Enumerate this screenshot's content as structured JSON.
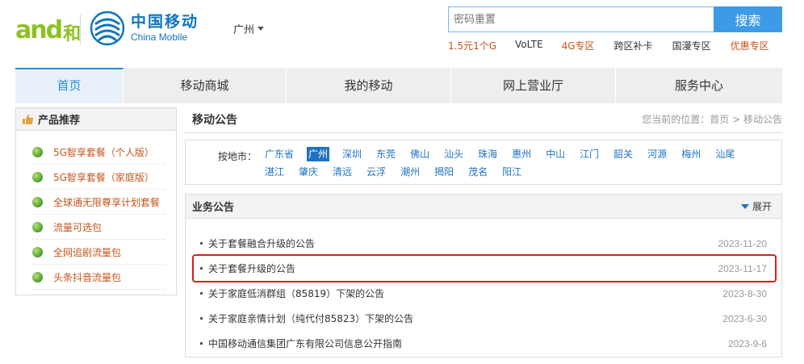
{
  "header": {
    "and_logo_text": "and",
    "he_logo_text": "和",
    "brand_cn": "中国移动",
    "brand_en": "China Mobile",
    "city": "广州",
    "search_placeholder": "密码重置",
    "search_button": "搜索",
    "quick_links": [
      {
        "label": "1.5元1个G",
        "color": "#c4541a",
        "offset": 0
      },
      {
        "label": "VoLTE",
        "color": "#333333",
        "offset": 23
      },
      {
        "label": "4G专区",
        "color": "#c4541a",
        "offset": 23
      },
      {
        "label": "跨区补卡",
        "color": "#333333",
        "offset": 24
      },
      {
        "label": "国漫专区",
        "color": "#333333",
        "offset": 24
      },
      {
        "label": "优惠专区",
        "color": "#c4541a",
        "offset": 24
      }
    ]
  },
  "nav": [
    {
      "label": "首页",
      "width": 134,
      "active": true
    },
    {
      "label": "移动商城",
      "width": 202,
      "active": false
    },
    {
      "label": "我的移动",
      "width": 204,
      "active": false
    },
    {
      "label": "网上营业厅",
      "width": 204,
      "active": false
    },
    {
      "label": "服务中心",
      "width": 206,
      "active": false
    }
  ],
  "sidebar": {
    "title": "产品推荐",
    "items": [
      "5G智享套餐（个人版）",
      "5G智享套餐（家庭版）",
      "全球通无限尊享计划套餐",
      "流量可选包",
      "全网追剧流量包",
      "头条抖音流量包"
    ]
  },
  "content": {
    "section_title": "移动公告",
    "breadcrumb_prefix": "您当前的位置：",
    "breadcrumb_home": "首页",
    "breadcrumb_sep": ">",
    "breadcrumb_current": "移动公告",
    "city_label": "按地市：",
    "cities": [
      "广东省",
      "广州",
      "深圳",
      "东莞",
      "佛山",
      "汕头",
      "珠海",
      "惠州",
      "中山",
      "江门",
      "韶关",
      "河源",
      "梅州",
      "汕尾",
      "湛江",
      "肇庆",
      "清远",
      "云浮",
      "潮州",
      "揭阳",
      "茂名",
      "阳江"
    ],
    "active_city_index": 1,
    "announcement_title": "业务公告",
    "expand_label": "展开",
    "announcements": [
      {
        "title": "关于套餐融合升级的公告",
        "date": "2023-11-20",
        "highlighted": false
      },
      {
        "title": "关于套餐升级的公告",
        "date": "2023-11-17",
        "highlighted": true
      },
      {
        "title": "关于家庭低消群组（85819）下架的公告",
        "date": "2023-8-30",
        "highlighted": false
      },
      {
        "title": "关于家庭亲情计划（纯代付85823）下架的公告",
        "date": "2023-6-30",
        "highlighted": false
      },
      {
        "title": "中国移动通信集团广东有限公司信息公开指南",
        "date": "2023-9-6",
        "highlighted": false
      }
    ]
  },
  "colors": {
    "accent_blue": "#2b8bd4",
    "link_blue": "#1f73c0",
    "orange": "#c4541a",
    "highlight_red": "#d9201a",
    "and_green": "#8dc21f"
  }
}
